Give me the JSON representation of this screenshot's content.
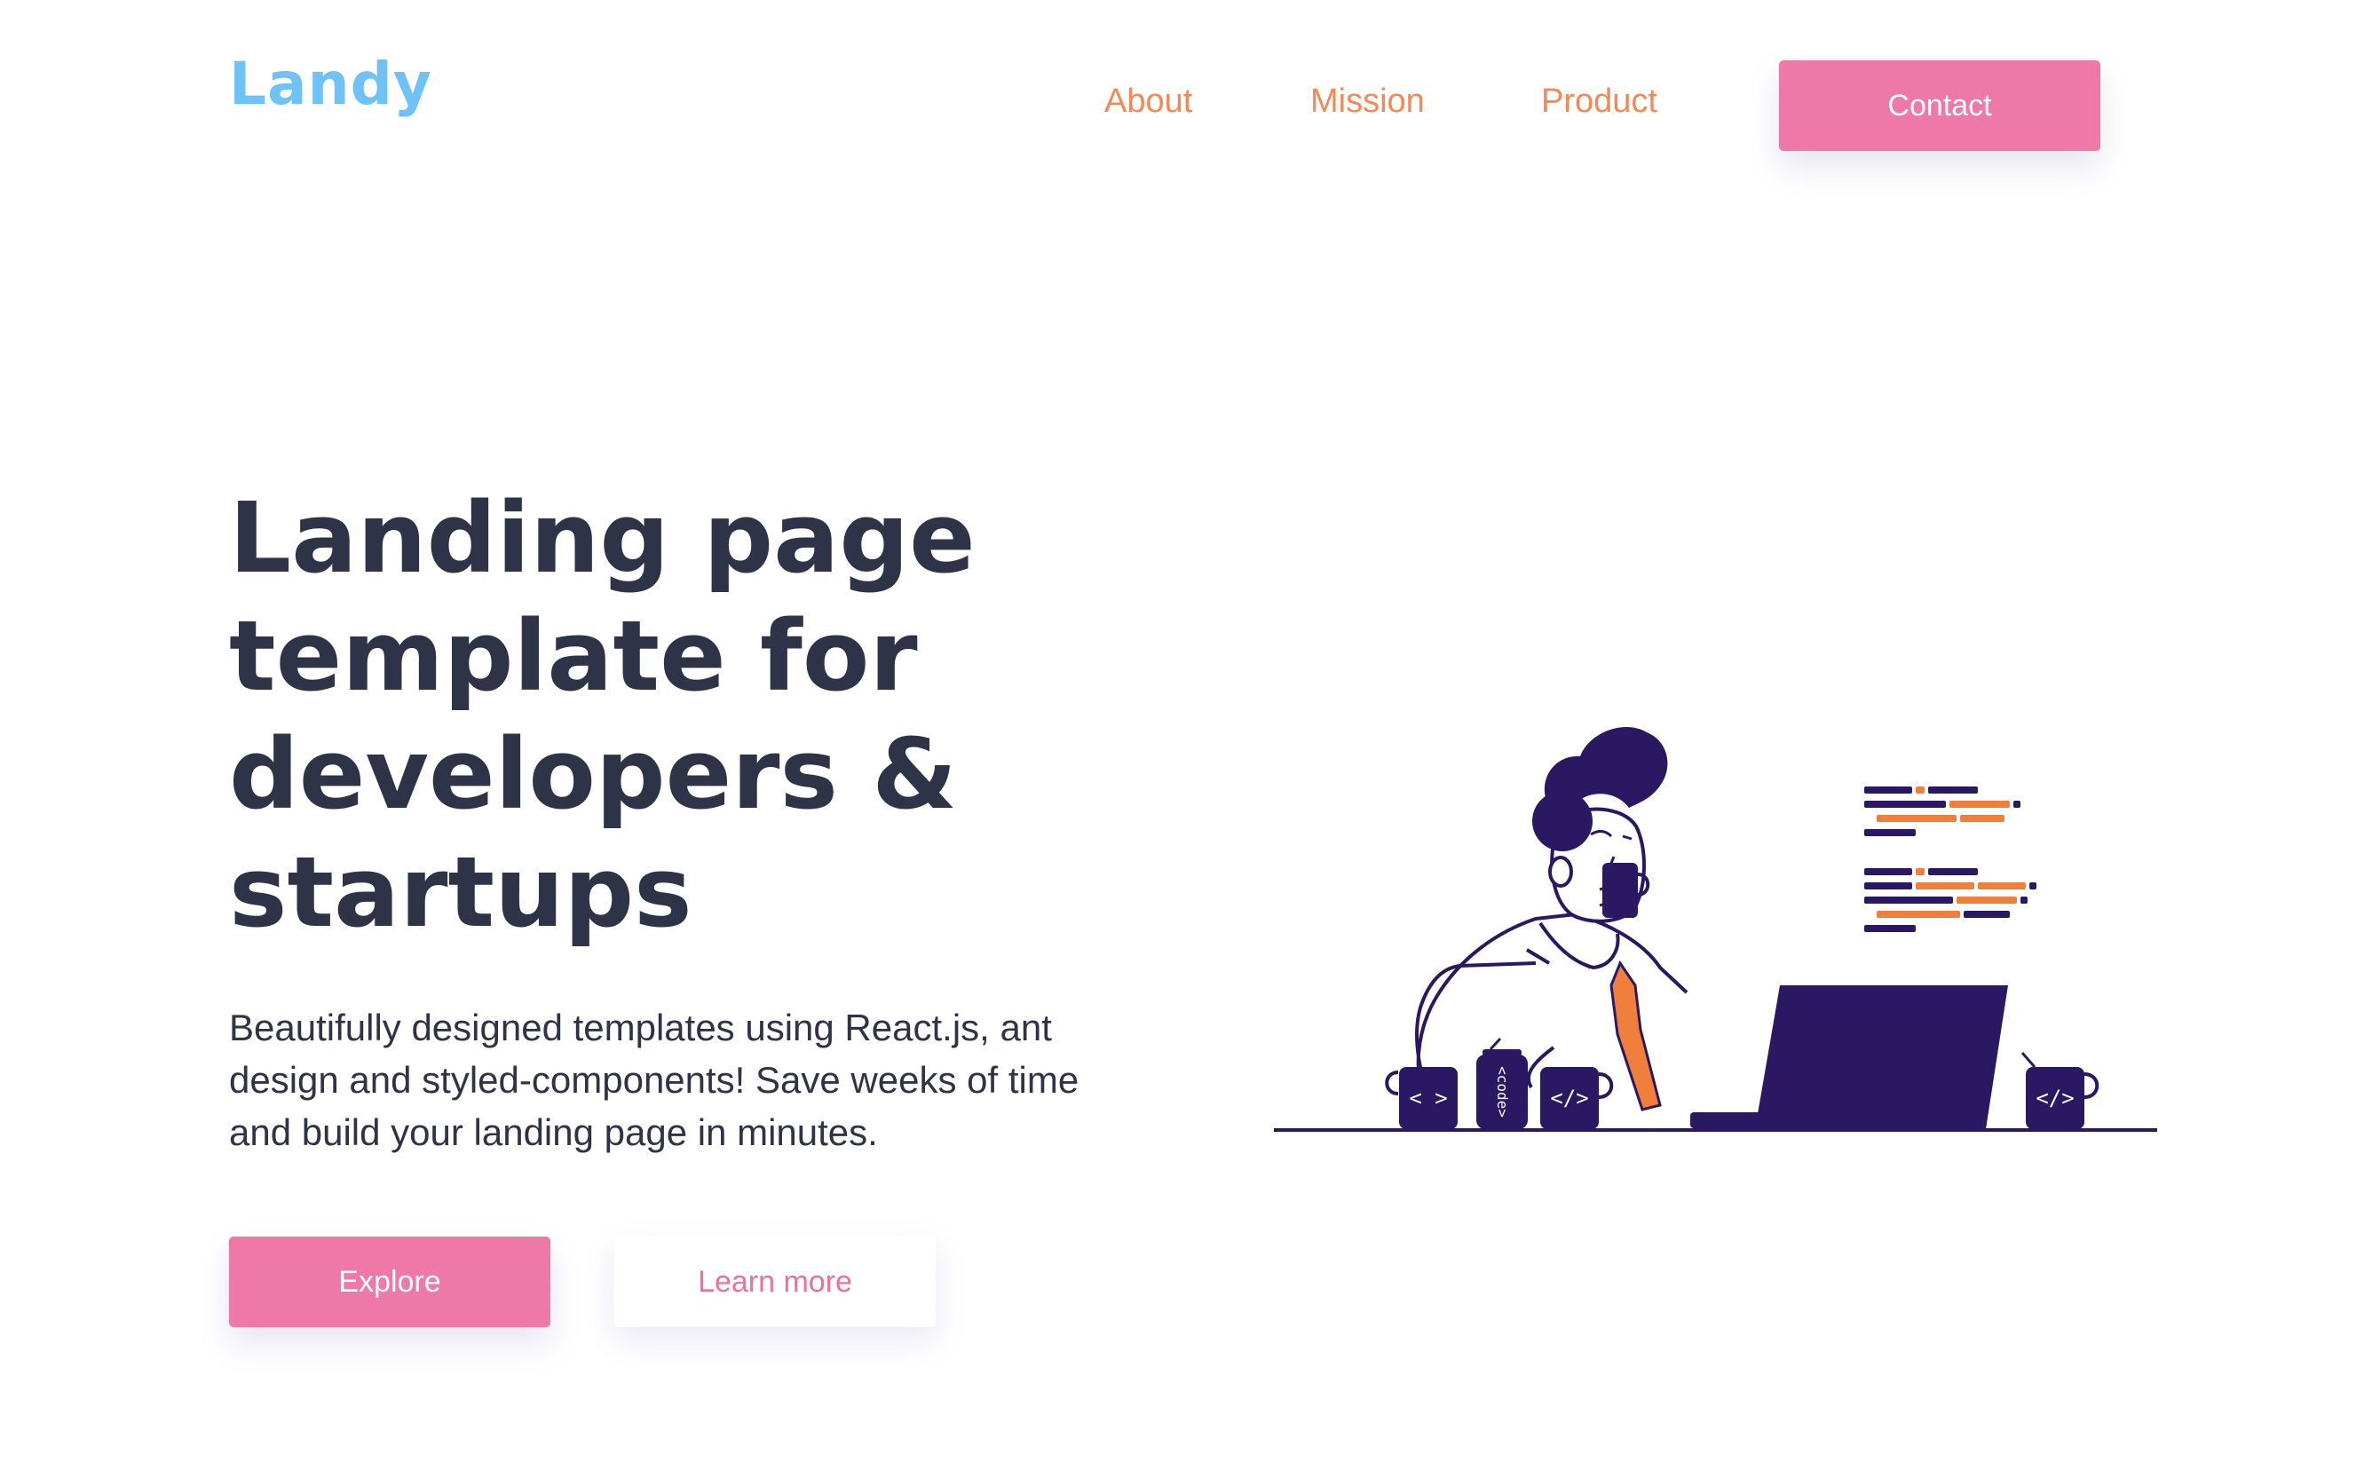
{
  "header": {
    "logo": "Landy",
    "nav": {
      "about": "About",
      "mission": "Mission",
      "product": "Product"
    },
    "contact_label": "Contact"
  },
  "hero": {
    "title": "Landing page template for developers & startups",
    "description": "Beautifully designed templates using React.js, ant design and styled-components! Save weeks of time and build your landing page in minutes.",
    "primary_button": "Explore",
    "secondary_button": "Learn more"
  },
  "illustration": {
    "mug_left_label": "< >",
    "can_label": "<code>",
    "mug_middle_label": "</>",
    "mug_right_label": "</>"
  },
  "colors": {
    "brand_blue": "#6fc2f7",
    "accent_pink": "#ee79a6",
    "nav_orange": "#ef8a59",
    "text_dark": "#2e3347",
    "illustration_purple": "#2b1863",
    "illustration_orange": "#ef7f3a"
  }
}
